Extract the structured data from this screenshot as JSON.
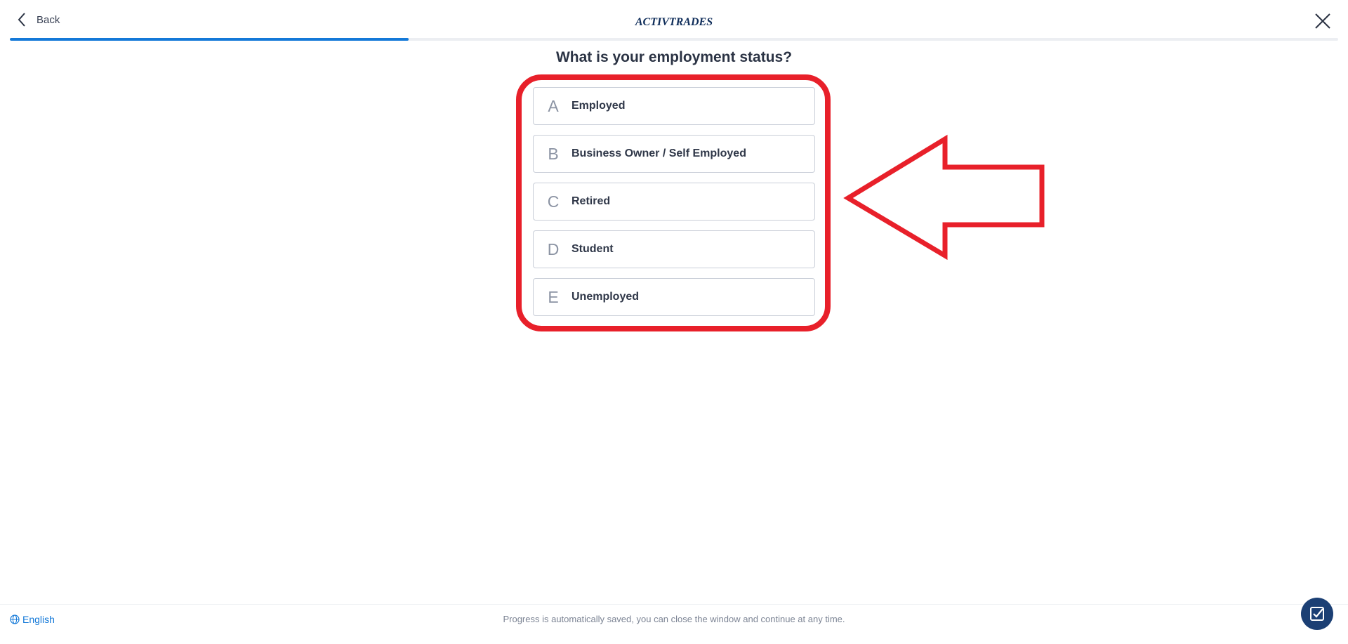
{
  "header": {
    "back_label": "Back",
    "logo_text": "ACTIVTRADES",
    "progress_fraction": 0.3
  },
  "question": {
    "title": "What is your employment status?",
    "options": [
      {
        "letter": "A",
        "label": "Employed"
      },
      {
        "letter": "B",
        "label": "Business Owner / Self Employed"
      },
      {
        "letter": "C",
        "label": "Retired"
      },
      {
        "letter": "D",
        "label": "Student"
      },
      {
        "letter": "E",
        "label": "Unemployed"
      }
    ]
  },
  "annotation": {
    "color": "#e8202a"
  },
  "footer": {
    "language": "English",
    "note": "Progress is automatically saved, you can close the window and continue at any time."
  },
  "colors": {
    "accent": "#1479d8",
    "brand_dark": "#1b3f74"
  },
  "icons": {
    "back": "chevron-left-icon",
    "close": "close-icon",
    "language": "globe-icon",
    "chat": "checkbox-icon"
  }
}
